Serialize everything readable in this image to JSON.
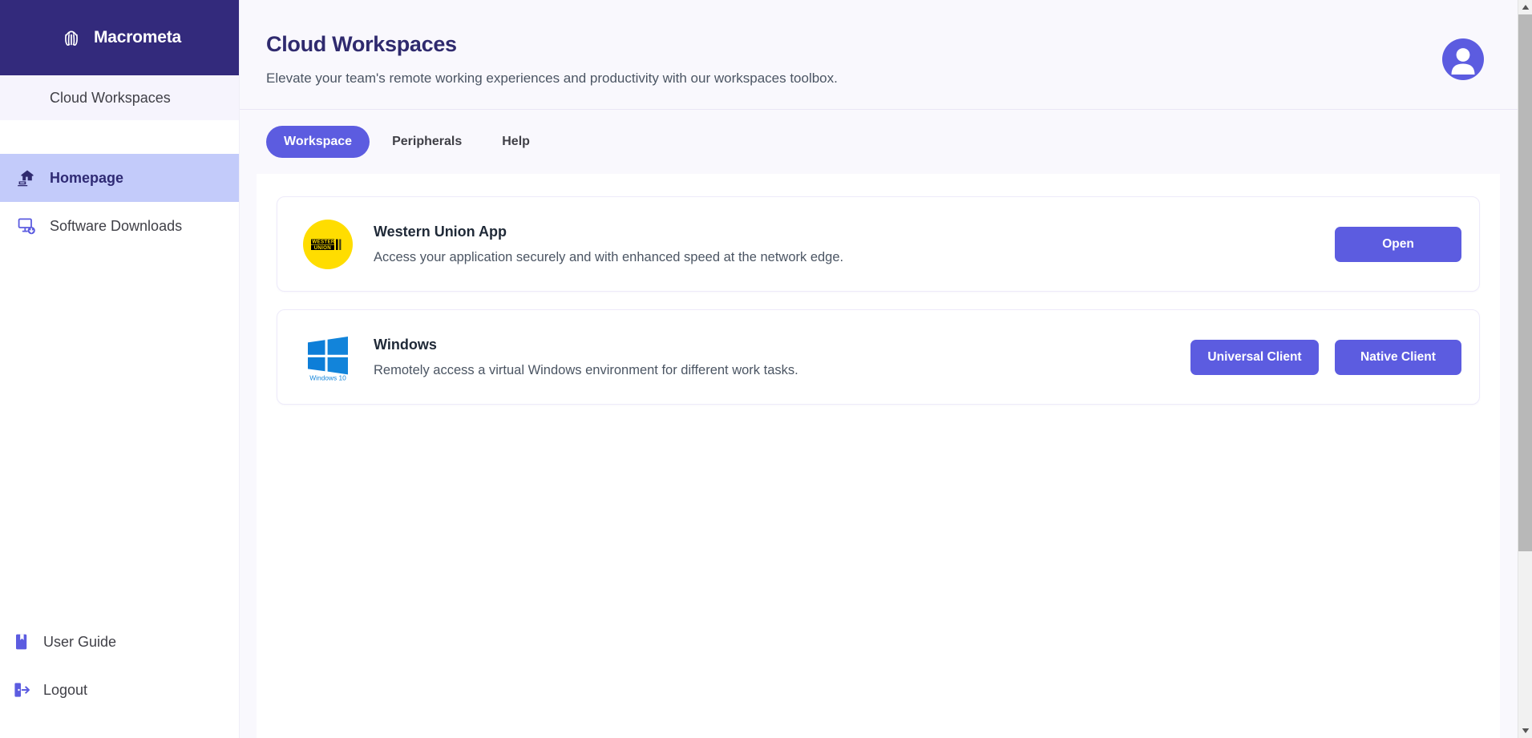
{
  "brand": {
    "name": "Macrometa",
    "logo_icon": "octopus-logo-icon",
    "bg_color": "#332a7c"
  },
  "sidebar": {
    "section_label": "Cloud Workspaces",
    "items": [
      {
        "label": "Homepage",
        "icon": "home-remote-icon",
        "active": true
      },
      {
        "label": "Software Downloads",
        "icon": "monitor-download-icon",
        "active": false
      }
    ],
    "bottom_items": [
      {
        "label": "User Guide",
        "icon": "book-icon"
      },
      {
        "label": "Logout",
        "icon": "logout-icon"
      }
    ]
  },
  "header": {
    "title": "Cloud Workspaces",
    "subtitle": "Elevate your team's remote working experiences and productivity with our workspaces toolbox.",
    "avatar_icon": "user-avatar-icon"
  },
  "tabs": [
    {
      "label": "Workspace",
      "active": true
    },
    {
      "label": "Peripherals",
      "active": false
    },
    {
      "label": "Help",
      "active": false
    }
  ],
  "cards": [
    {
      "title": "Western Union App",
      "description": "Access your application securely and with enhanced speed at the network edge.",
      "logo_icon": "western-union-logo-icon",
      "logo_text_line1": "WESTERN",
      "logo_text_line2": "UNION",
      "logo_bg_color": "#ffdd00",
      "actions": [
        {
          "label": "Open",
          "style": "primary"
        }
      ]
    },
    {
      "title": "Windows",
      "description": "Remotely access a virtual Windows environment for different work tasks.",
      "logo_icon": "windows-10-logo-icon",
      "logo_caption": "Windows 10",
      "logo_bg_color": "#0d7ed8",
      "actions": [
        {
          "label": "Universal Client",
          "style": "primary"
        },
        {
          "label": "Native Client",
          "style": "primary"
        }
      ]
    }
  ],
  "colors": {
    "accent": "#5c5ce0",
    "brand_dark": "#332a7c",
    "active_nav_bg": "#c3cbfa",
    "content_bg": "#f9f8fd"
  },
  "scrollbar": {
    "up_arrow": "scroll-up-icon",
    "down_arrow": "scroll-down-icon"
  }
}
